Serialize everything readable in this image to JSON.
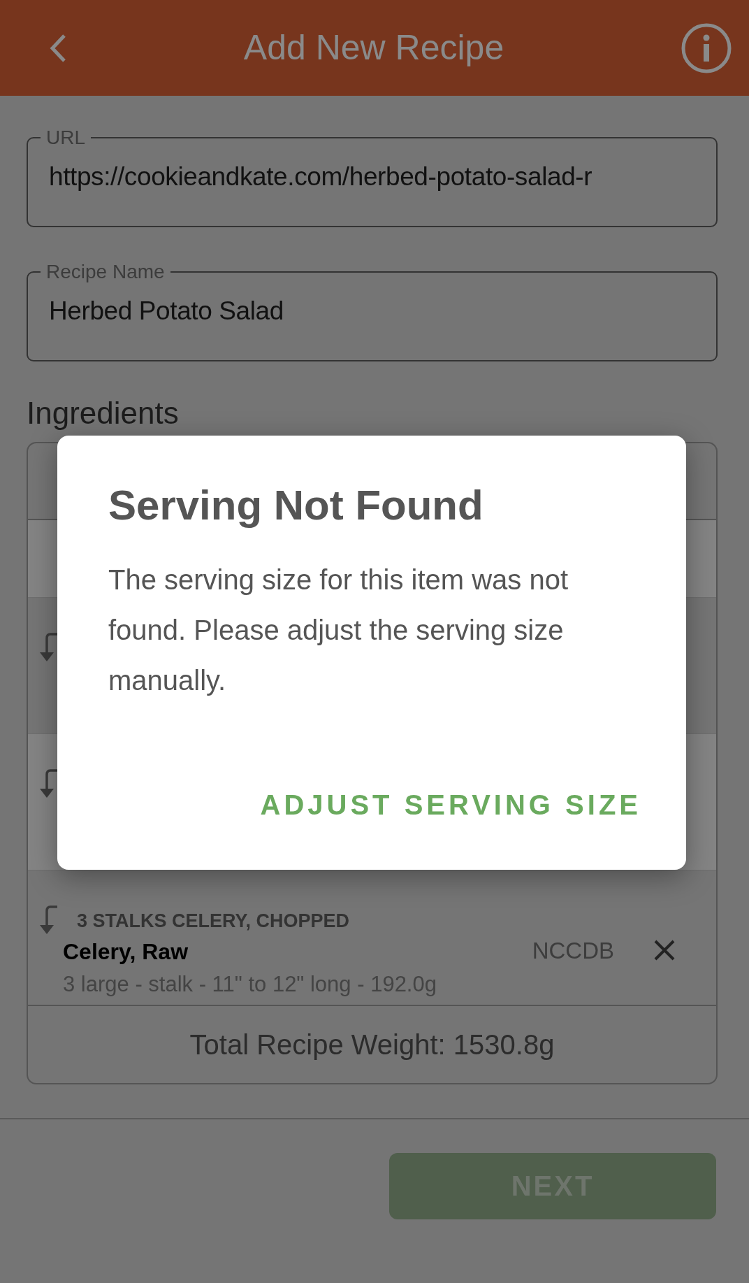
{
  "header": {
    "title": "Add New Recipe"
  },
  "fields": [
    {
      "label": "URL",
      "value": "https://cookieandkate.com/herbed-potato-salad-r"
    },
    {
      "label": "Recipe Name",
      "value": "Herbed Potato Salad"
    }
  ],
  "section_title": "Ingredients",
  "ingredients": [
    {
      "kind": "band",
      "shaded": true
    },
    {
      "kind": "covered",
      "shaded": false
    },
    {
      "kind": "covered",
      "shaded": true
    },
    {
      "kind": "item",
      "shaded": false,
      "original_text": "3 STALKS CELERY, CHOPPED",
      "name": "Celery, Raw",
      "serving": "3 large - stalk - 11\" to 12\" long - 192.0g",
      "source": "NCCDB"
    }
  ],
  "total": "Total Recipe Weight: 1530.8g",
  "next_button": {
    "label": "NEXT",
    "disabled": true
  },
  "dialog": {
    "title": "Serving Not Found",
    "message": "The serving size for this item was not found. Please adjust the serving size manually.",
    "action": "ADJUST SERVING SIZE"
  }
}
